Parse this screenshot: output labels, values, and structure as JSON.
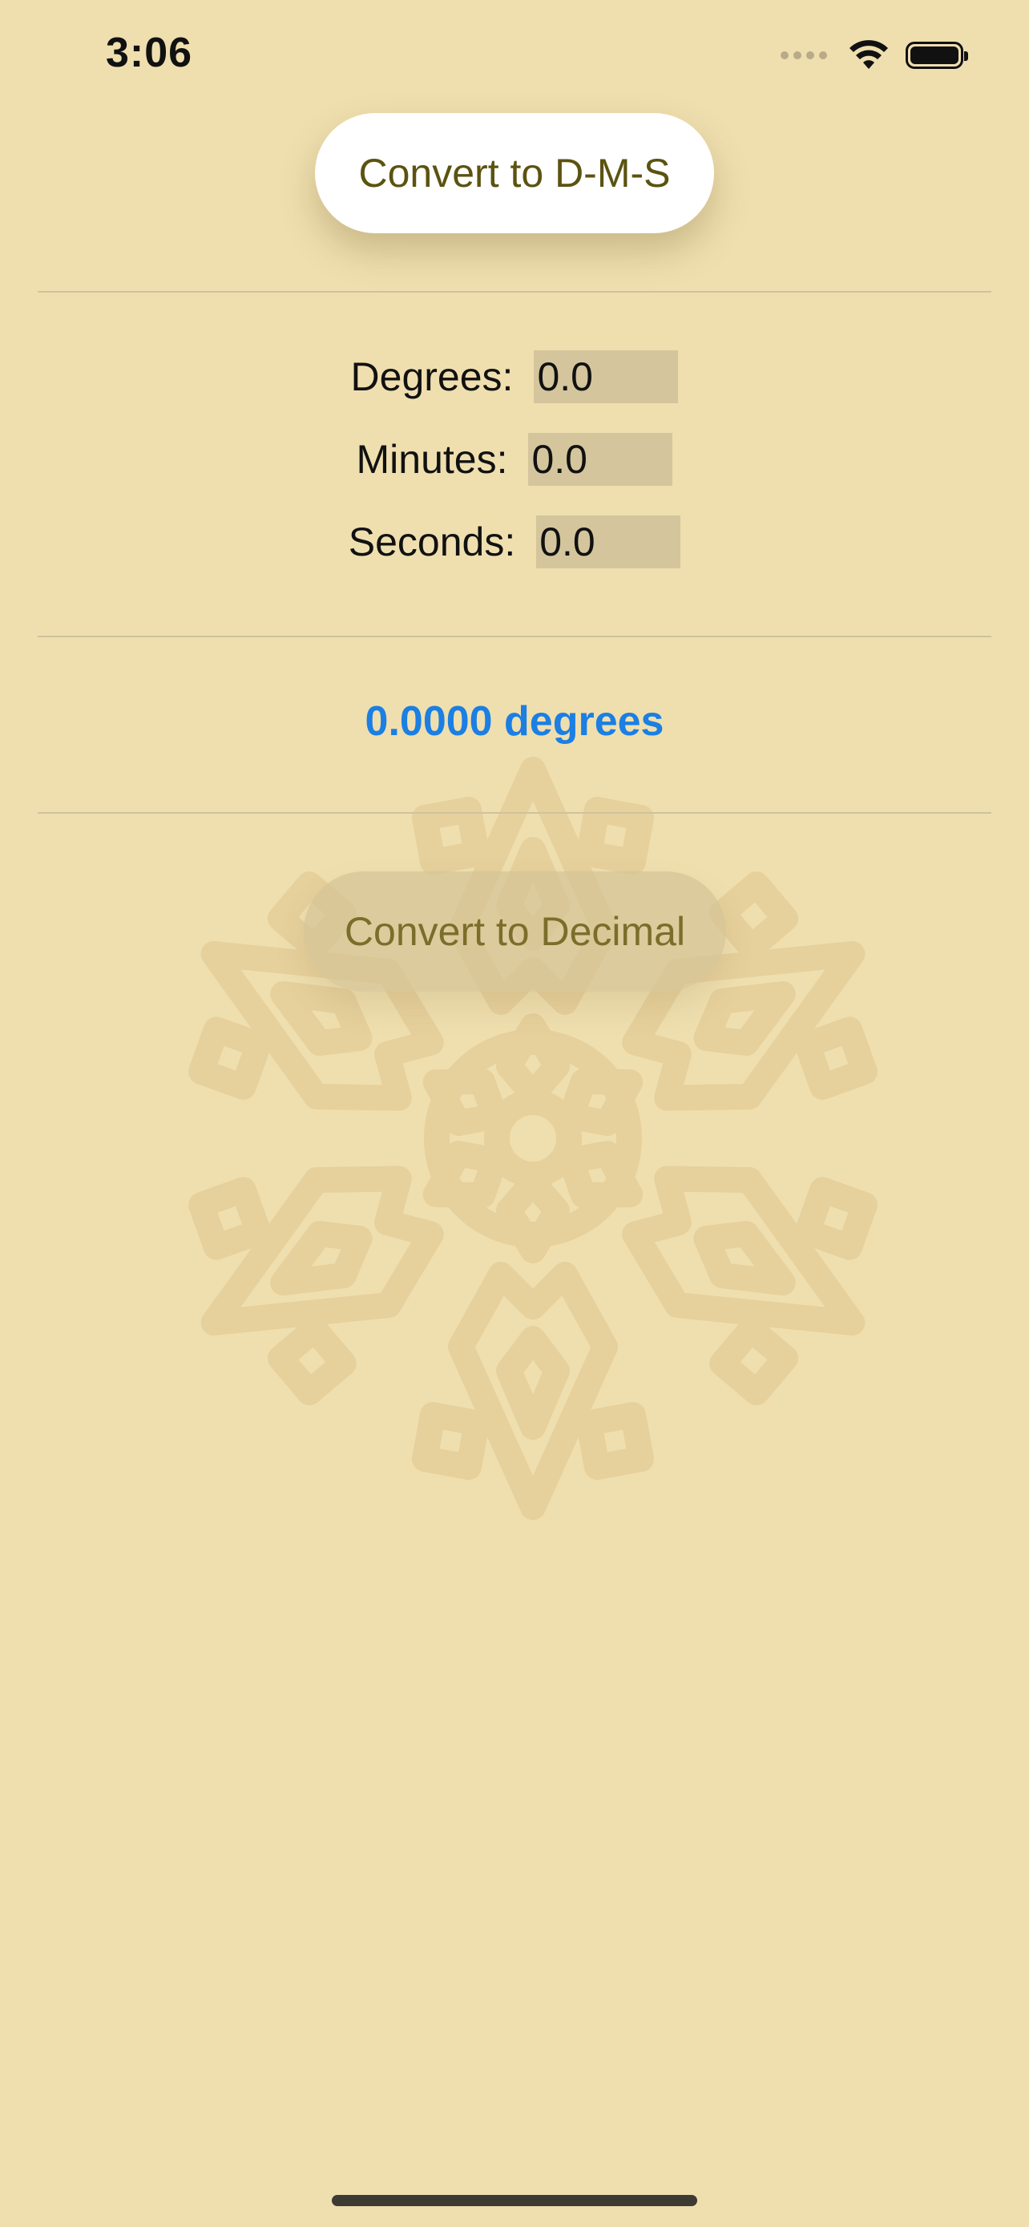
{
  "status_bar": {
    "time": "3:06"
  },
  "colors": {
    "background": "#EFDFAF",
    "button_text": "#5B5310",
    "result_text": "#1B7FE3",
    "input_background": "#D4C59D",
    "snowflake": "#E6D09C"
  },
  "buttons": {
    "convert_dms_label": "Convert to D-M-S",
    "convert_decimal_label": "Convert to Decimal"
  },
  "fields": {
    "degrees": {
      "label": "Degrees:",
      "value": "0.0"
    },
    "minutes": {
      "label": "Minutes:",
      "value": "0.0"
    },
    "seconds": {
      "label": "Seconds:",
      "value": "0.0"
    }
  },
  "result": {
    "text": "0.0000 degrees"
  },
  "icons": {
    "background_graphic": "snowflake-icon",
    "wifi": "wifi-icon",
    "battery": "battery-icon",
    "signal": "cellular-signal-icon"
  }
}
